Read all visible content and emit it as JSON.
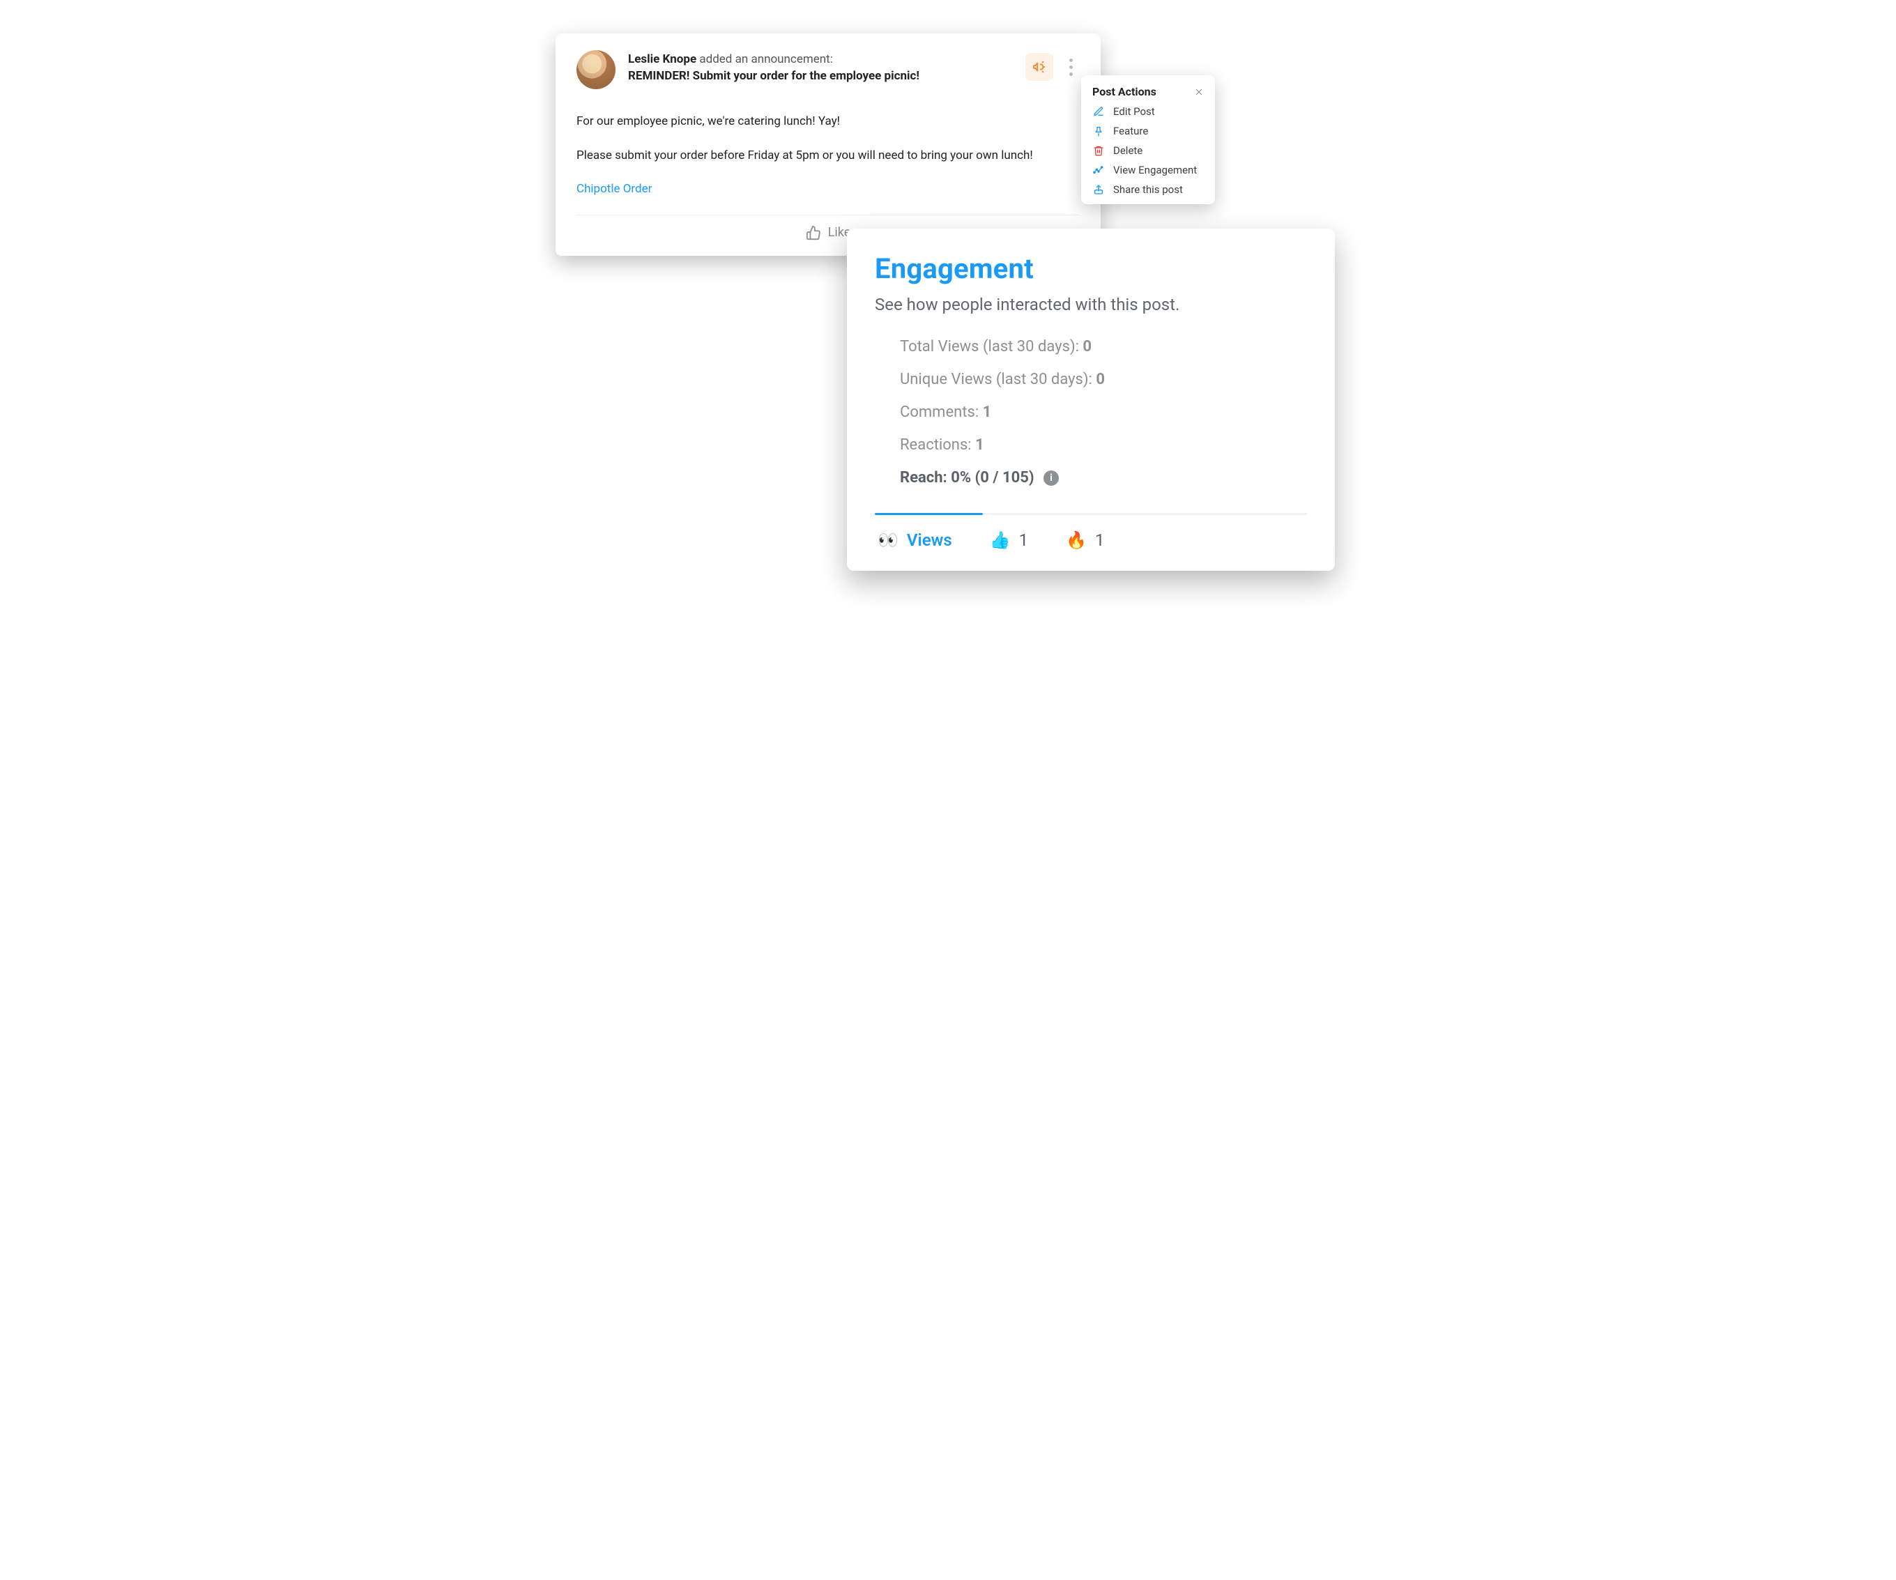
{
  "post": {
    "author_name": "Leslie Knope",
    "verb_text": "added an announcement:",
    "subject": "REMINDER! Submit your order for the employee picnic!",
    "paragraph1": "For our employee picnic, we're catering lunch! Yay!",
    "paragraph2": "Please submit your order before Friday at 5pm or you will need to bring your own lunch!",
    "link_text": "Chipotle Order",
    "like_label": "Like"
  },
  "actions": {
    "title": "Post Actions",
    "items": {
      "edit": "Edit Post",
      "feature": "Feature",
      "delete": "Delete",
      "view_engagement": "View Engagement",
      "share": "Share this post"
    }
  },
  "engagement": {
    "title": "Engagement",
    "subtitle": "See how people interacted with this post.",
    "stats": {
      "total_views_label": "Total Views (last 30 days): ",
      "total_views_value": "0",
      "unique_views_label": "Unique Views (last 30 days): ",
      "unique_views_value": "0",
      "comments_label": "Comments: ",
      "comments_value": "1",
      "reactions_label": "Reactions: ",
      "reactions_value": "1",
      "reach_text": "Reach: 0% (0 / 105)"
    },
    "tabs": {
      "views_label": "Views",
      "thumb_count": "1",
      "fire_count": "1"
    }
  },
  "icons": {
    "eyes": "👀",
    "thumb": "👍",
    "fire": "🔥"
  },
  "colors": {
    "accent": "#1a9af2",
    "danger": "#e23b3b",
    "muted": "#8b9096"
  }
}
